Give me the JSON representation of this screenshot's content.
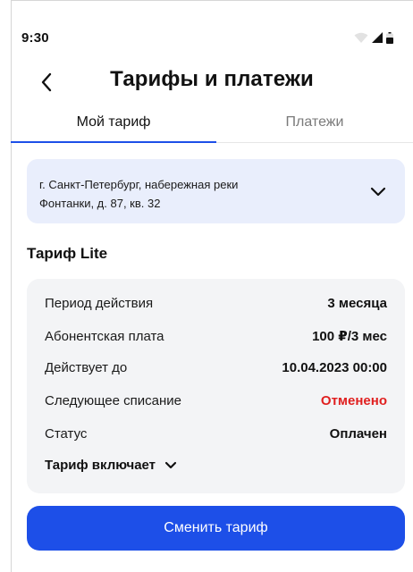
{
  "status_bar": {
    "time": "9:30",
    "icons": [
      "wifi-icon",
      "signal-icon",
      "battery-icon"
    ]
  },
  "header": {
    "back_icon": "chevron-left-icon",
    "title": "Тарифы и платежи"
  },
  "tabs": [
    {
      "label": "Мой тариф",
      "active": true
    },
    {
      "label": "Платежи",
      "active": false
    }
  ],
  "address": {
    "line1": "г. Санкт-Петербург, набережная реки",
    "line2": "Фонтанки, д. 87, кв. 32",
    "icon": "chevron-down-icon"
  },
  "tariff": {
    "title": "Тариф Lite",
    "rows": [
      {
        "label": "Период действия",
        "value": "3 месяца"
      },
      {
        "label": "Абонентская плата",
        "value": "100 ₽/3 мес"
      },
      {
        "label": "Действует до",
        "value": "10.04.2023 00:00"
      },
      {
        "label": "Следующее списание",
        "value": "Отменено"
      },
      {
        "label": "Статус",
        "value": "Оплачен"
      }
    ],
    "includes_label": "Тариф включает"
  },
  "actions": {
    "change_label": "Сменить тариф"
  },
  "colors": {
    "accent": "#1d4fe8",
    "cancel": "#e01f1f",
    "address_bg": "#e9eefc",
    "card_bg": "#f3f4f6"
  }
}
